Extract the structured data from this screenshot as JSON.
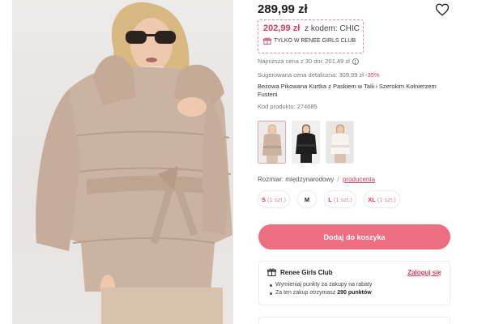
{
  "product": {
    "price": "289,99 zł",
    "promo": {
      "price": "202,99 zł",
      "code_text": "z kodem: CHIC",
      "club_text": "TYLKO W RENEE GIRLS CLUB"
    },
    "lowest_price": "Najniższa cena z 30 dni: 201,49 zł",
    "suggested_price": "Sugerowana cena detaliczna: 309,99 zł",
    "discount": "-35%",
    "name": "Beżowa Pikowana Kurtka z Paskiem w Talii i Szerokim Kołnierzem Fusteni",
    "code": "Kod produktu: 274685"
  },
  "thumbnails": [
    {
      "name": "beige",
      "color": "#cfb5a2"
    },
    {
      "name": "black",
      "color": "#1e1e1e"
    },
    {
      "name": "white",
      "color": "#efeae4"
    }
  ],
  "size_selector": {
    "label": "Rozmiar:",
    "system": "międzynarodowy",
    "separator": "/",
    "alt_link": "producenta"
  },
  "sizes": [
    {
      "size": "S",
      "stock": "(1 szt.)",
      "low_stock": true
    },
    {
      "size": "M",
      "stock": "",
      "low_stock": false
    },
    {
      "size": "L",
      "stock": "(1 szt.)",
      "low_stock": true
    },
    {
      "size": "XL",
      "stock": "(1 szt.)",
      "low_stock": true
    }
  ],
  "cart": {
    "label": "Dodaj do koszyka"
  },
  "club": {
    "title": "Renee Girls Club",
    "login_label": "Zaloguj się",
    "bullet1": "Wymieniaj punkty za zakupy na rabaty",
    "bullet2_prefix": "Za ten zakup otrzymasz",
    "bullet2_points": "290 punktów"
  },
  "icons": {
    "wishlist": "heart-icon",
    "gift": "gift-icon",
    "info": "info-icon"
  },
  "colors": {
    "accent": "#ec6e80",
    "accent_text": "#d83b5d",
    "coat": "#cbb3a1"
  }
}
